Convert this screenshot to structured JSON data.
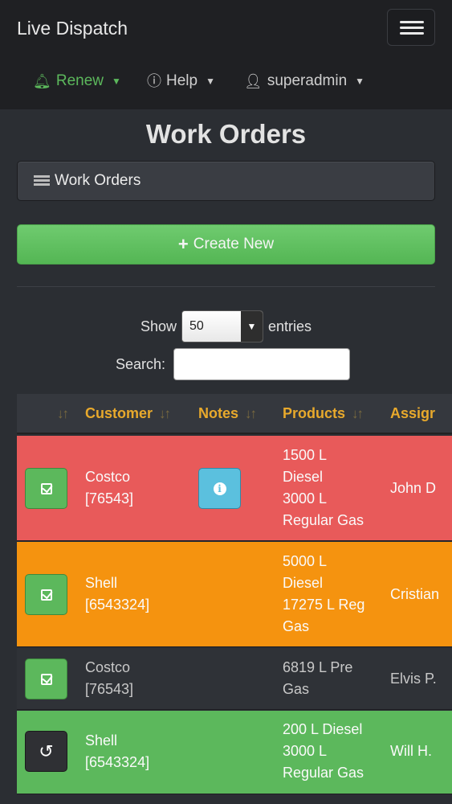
{
  "navbar": {
    "brand": "Live Dispatch",
    "items": [
      {
        "label": "Renew",
        "icon": "bell-icon"
      },
      {
        "label": "Help",
        "icon": "info-circle-icon"
      },
      {
        "label": "superadmin",
        "icon": "user-icon"
      }
    ]
  },
  "page": {
    "title": "Work Orders",
    "panel_title": "Work Orders",
    "create_label": "Create New"
  },
  "table_controls": {
    "show_label": "Show",
    "entries_value": "50",
    "entries_label": "entries",
    "search_label": "Search:",
    "search_value": ""
  },
  "table": {
    "columns": [
      "",
      "Customer",
      "Notes",
      "Products",
      "Assigr"
    ],
    "rows": [
      {
        "status": "red",
        "action": "check",
        "customer": [
          "Costco",
          "[76543]"
        ],
        "notes": "info",
        "products": [
          "1500 L",
          "Diesel",
          "3000 L",
          "Regular Gas"
        ],
        "assigned": "John D"
      },
      {
        "status": "orange",
        "action": "check",
        "customer": [
          "Shell",
          "[6543324]"
        ],
        "notes": "",
        "products": [
          "5000 L",
          "Diesel",
          "17275 L Reg",
          "Gas"
        ],
        "assigned": "Cristian"
      },
      {
        "status": "dark",
        "action": "check",
        "customer": [
          "Costco",
          "[76543]"
        ],
        "notes": "",
        "products": [
          "6819 L Pre",
          "Gas"
        ],
        "assigned": "Elvis P."
      },
      {
        "status": "green",
        "action": "undo",
        "customer": [
          "Shell",
          "[6543324]"
        ],
        "notes": "",
        "products": [
          "200 L Diesel",
          "3000 L",
          "Regular Gas"
        ],
        "assigned": "Will H."
      }
    ]
  },
  "colors": {
    "accent_green": "#5cb85c",
    "header_gold": "#e8a92c",
    "row_red": "#e85a5a",
    "row_orange": "#f5930f",
    "info_blue": "#5bc0de"
  }
}
